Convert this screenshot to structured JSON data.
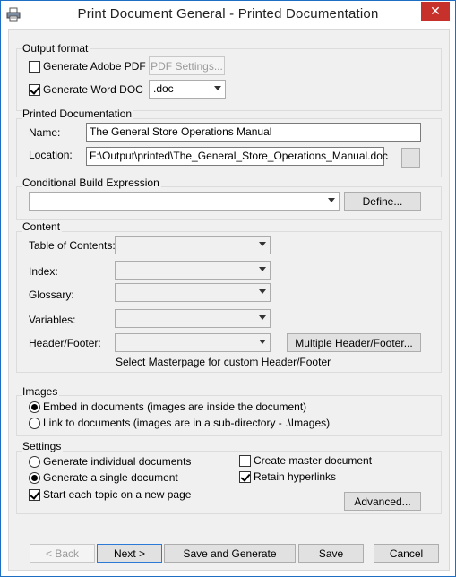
{
  "window": {
    "title": "Print Document General - Printed Documentation",
    "close_glyph": "✕"
  },
  "output_format": {
    "label": "Output format",
    "adobe_pdf": {
      "label": "Generate Adobe PDF",
      "checked": false
    },
    "pdf_settings_button": "PDF Settings...",
    "word_doc": {
      "label": "Generate Word DOC",
      "checked": true
    },
    "doc_format": ".doc"
  },
  "printed_documentation": {
    "label": "Printed Documentation",
    "name_label": "Name:",
    "name_value": "The General Store Operations Manual",
    "location_label": "Location:",
    "location_value": "F:\\Output\\printed\\The_General_Store_Operations_Manual.doc"
  },
  "conditional_build": {
    "label": "Conditional Build Expression",
    "value": "",
    "define_button": "Define..."
  },
  "content": {
    "label": "Content",
    "toc_label": "Table of Contents:",
    "index_label": "Index:",
    "glossary_label": "Glossary:",
    "variables_label": "Variables:",
    "header_footer_label": "Header/Footer:",
    "multiple_header_button": "Multiple Header/Footer...",
    "masterpage_hint": "Select Masterpage for custom Header/Footer"
  },
  "images": {
    "label": "Images",
    "embed": {
      "label": "Embed in documents (images are inside the document)",
      "selected": true
    },
    "link": {
      "label": "Link to documents (images are in a sub-directory - .\\Images)",
      "selected": false
    }
  },
  "settings": {
    "label": "Settings",
    "individual": {
      "label": "Generate individual documents",
      "selected": false
    },
    "single": {
      "label": "Generate a single document",
      "selected": true
    },
    "new_page": {
      "label": "Start each topic on a new page",
      "checked": true
    },
    "master": {
      "label": "Create master document",
      "checked": false
    },
    "hyperlinks": {
      "label": "Retain hyperlinks",
      "checked": true
    },
    "advanced_button": "Advanced..."
  },
  "footer": {
    "back": "< Back",
    "next": "Next >",
    "save_generate": "Save and Generate",
    "save": "Save",
    "cancel": "Cancel"
  }
}
